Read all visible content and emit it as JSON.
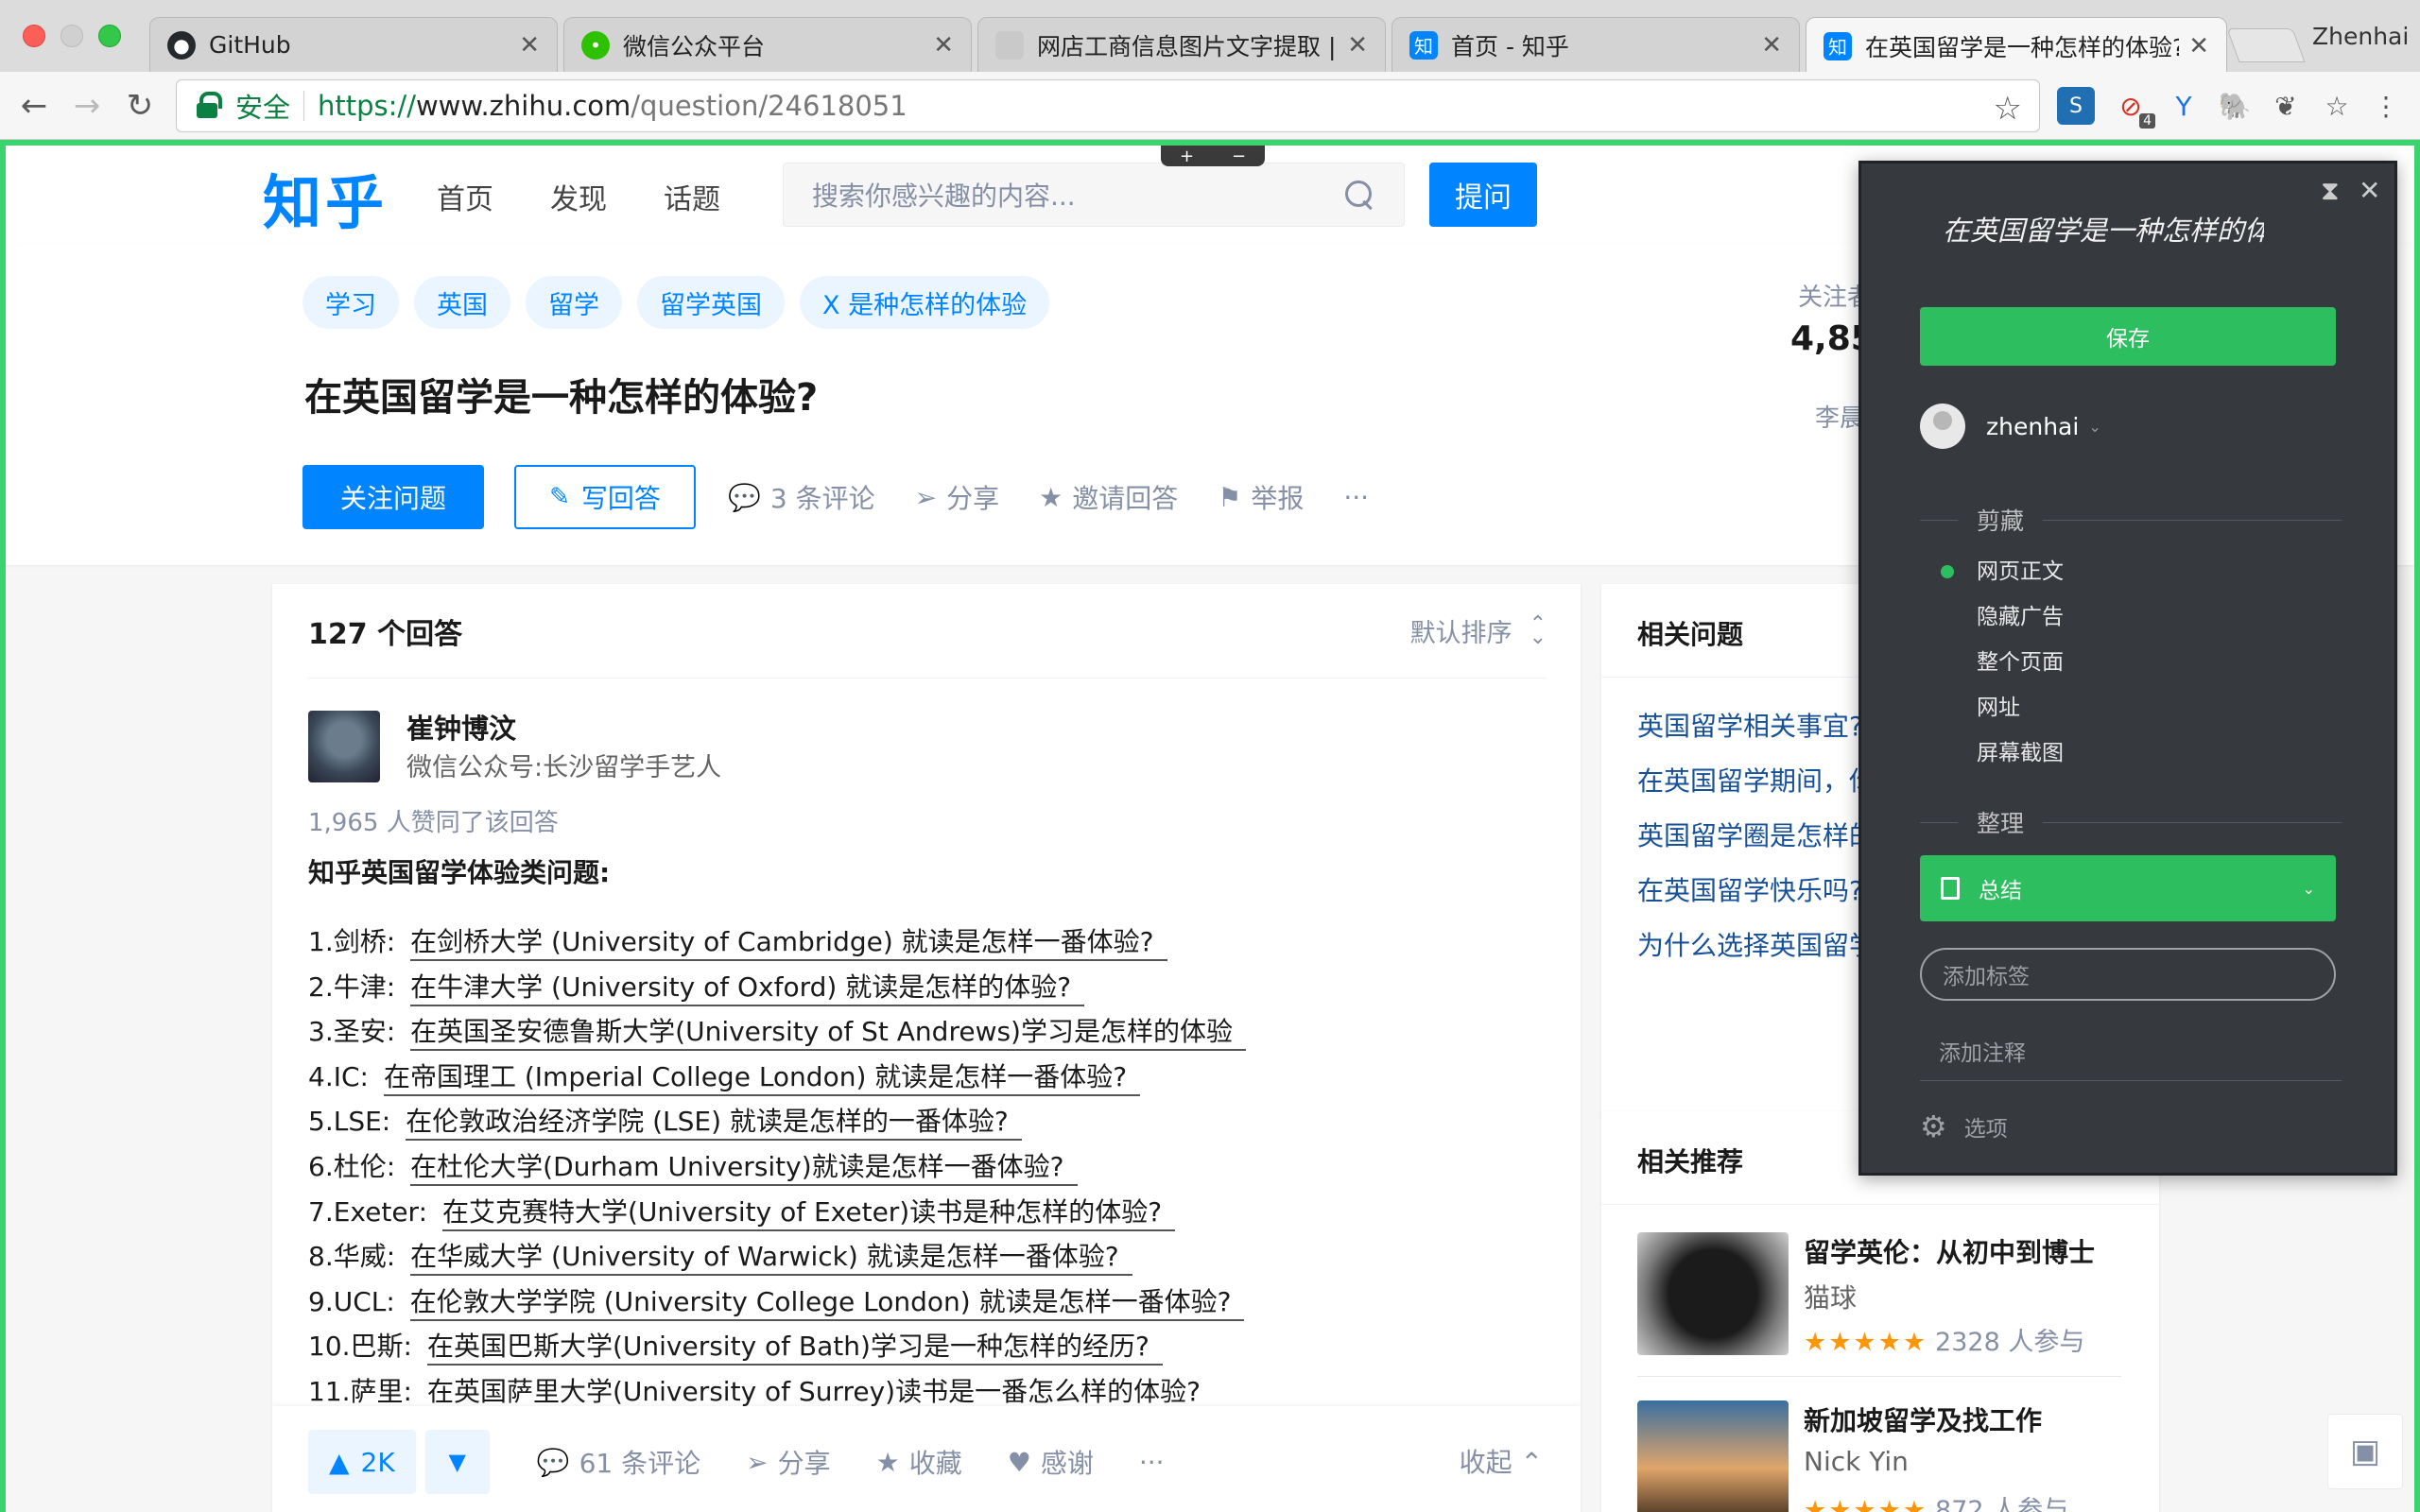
{
  "browser": {
    "tabs": [
      {
        "title": "GitHub",
        "icon": "github-icon",
        "color": "#24292e"
      },
      {
        "title": "微信公众平台",
        "icon": "wechat-icon",
        "color": "#2dc100"
      },
      {
        "title": "网店工商信息图片文字提取 | 讯",
        "icon": "avatar-icon",
        "color": "#c9c9c9"
      },
      {
        "title": "首页 - 知乎",
        "icon": "zhihu-icon",
        "color": "#0084ff"
      },
      {
        "title": "在英国留学是一种怎样的体验?",
        "icon": "zhihu-icon",
        "color": "#0084ff"
      }
    ],
    "profile_name": "Zhenhai",
    "secure_label": "安全",
    "url_scheme": "https://",
    "url_host": "www.zhihu.com",
    "url_path": "/question/24618051",
    "extension_badge": "4",
    "icons": [
      "back-icon",
      "forward-icon",
      "reload-icon",
      "star-icon",
      "menu-icon"
    ]
  },
  "zhihu": {
    "logo": "知乎",
    "nav": [
      "首页",
      "发现",
      "话题"
    ],
    "search_placeholder": "搜索你感兴趣的内容...",
    "ask_label": "提问",
    "brand_color": "#0084ff",
    "question": {
      "topics": [
        "学习",
        "英国",
        "留学",
        "留学英国",
        "X 是种怎样的体验"
      ],
      "title": "在英国留学是一种怎样的体验?",
      "follow_label": "关注问题",
      "write_label": "写回答",
      "actions": [
        {
          "icon": "comment-icon",
          "label": "3 条评论"
        },
        {
          "icon": "share-icon",
          "label": "分享"
        },
        {
          "icon": "invite-icon",
          "label": "邀请回答"
        },
        {
          "icon": "flag-icon",
          "label": "举报"
        },
        {
          "icon": "more-icon",
          "label": "···"
        }
      ],
      "followers_label": "关注者",
      "followers_count": "4,85",
      "side_author": "李晨"
    },
    "answers": {
      "count_label": "127 个回答",
      "sort_label": "默认排序",
      "author_name": "崔钟博汶",
      "author_bio": "微信公众号:长沙留学手艺人",
      "votes_text": "1,965 人赞同了该回答",
      "lead": "知乎英国留学体验类问题:",
      "items": [
        {
          "num": "1.剑桥:",
          "text": "在剑桥大学 (University of Cambridge) 就读是怎样一番体验?"
        },
        {
          "num": "2.牛津:",
          "text": "在牛津大学 (University of Oxford) 就读是怎样的体验?"
        },
        {
          "num": "3.圣安:",
          "text": "在英国圣安德鲁斯大学(University of St Andrews)学习是怎样的体验"
        },
        {
          "num": "4.IC:",
          "text": "在帝国理工 (Imperial College London) 就读是怎样一番体验?"
        },
        {
          "num": "5.LSE:",
          "text": "在伦敦政治经济学院 (LSE) 就读是怎样的一番体验?"
        },
        {
          "num": "6.杜伦:",
          "text": "在杜伦大学(Durham University)就读是怎样一番体验?"
        },
        {
          "num": "7.Exeter:",
          "text": "在艾克赛特大学(University of Exeter)读书是种怎样的体验?"
        },
        {
          "num": "8.华威:",
          "text": "在华威大学 (University of Warwick) 就读是怎样一番体验?"
        },
        {
          "num": "9.UCL:",
          "text": "在伦敦大学学院 (University College London) 就读是怎样一番体验?"
        },
        {
          "num": "10.巴斯:",
          "text": "在英国巴斯大学(University of Bath)学习是一种怎样的经历?"
        },
        {
          "num": "11.萨里:",
          "text": "在英国萨里大学(University of Surrey)读书是一番怎么样的体验?"
        }
      ],
      "footer": {
        "upvote_label": "2K",
        "comments_label": "61 条评论",
        "share_label": "分享",
        "collect_label": "收藏",
        "thanks_label": "感谢",
        "more_label": "···",
        "collapse_label": "收起"
      }
    },
    "related": {
      "title": "相关问题",
      "items": [
        "英国留学相关事宜?",
        "在英国留学期间，你什么?你是如何处理",
        "英国留学圈是怎样的答",
        "在英国留学快乐吗?",
        "为什么选择英国留学"
      ]
    },
    "recommend": {
      "title": "相关推荐",
      "items": [
        {
          "title": "留学英伦：从初中到博士",
          "author": "猫球",
          "stars": "★★★★★",
          "rating": 4.5,
          "count": "2328 人参与"
        },
        {
          "title": "新加坡留学及找工作",
          "author": "Nick Yin",
          "stars": "★★★★★",
          "rating": 4.5,
          "count": "872 人参与"
        }
      ]
    }
  },
  "clipper": {
    "title": "在英国留学是一种怎样的体",
    "save_label": "保存",
    "username": "zhenhai",
    "clip_section": "剪藏",
    "options": [
      "网页正文",
      "隐藏广告",
      "整个页面",
      "网址",
      "屏幕截图"
    ],
    "selected_option": "网页正文",
    "organize_section": "整理",
    "notebook": "总结",
    "tags_placeholder": "添加标签",
    "note_label": "添加注释",
    "settings_label": "选项",
    "accent_color": "#2dbe60"
  }
}
